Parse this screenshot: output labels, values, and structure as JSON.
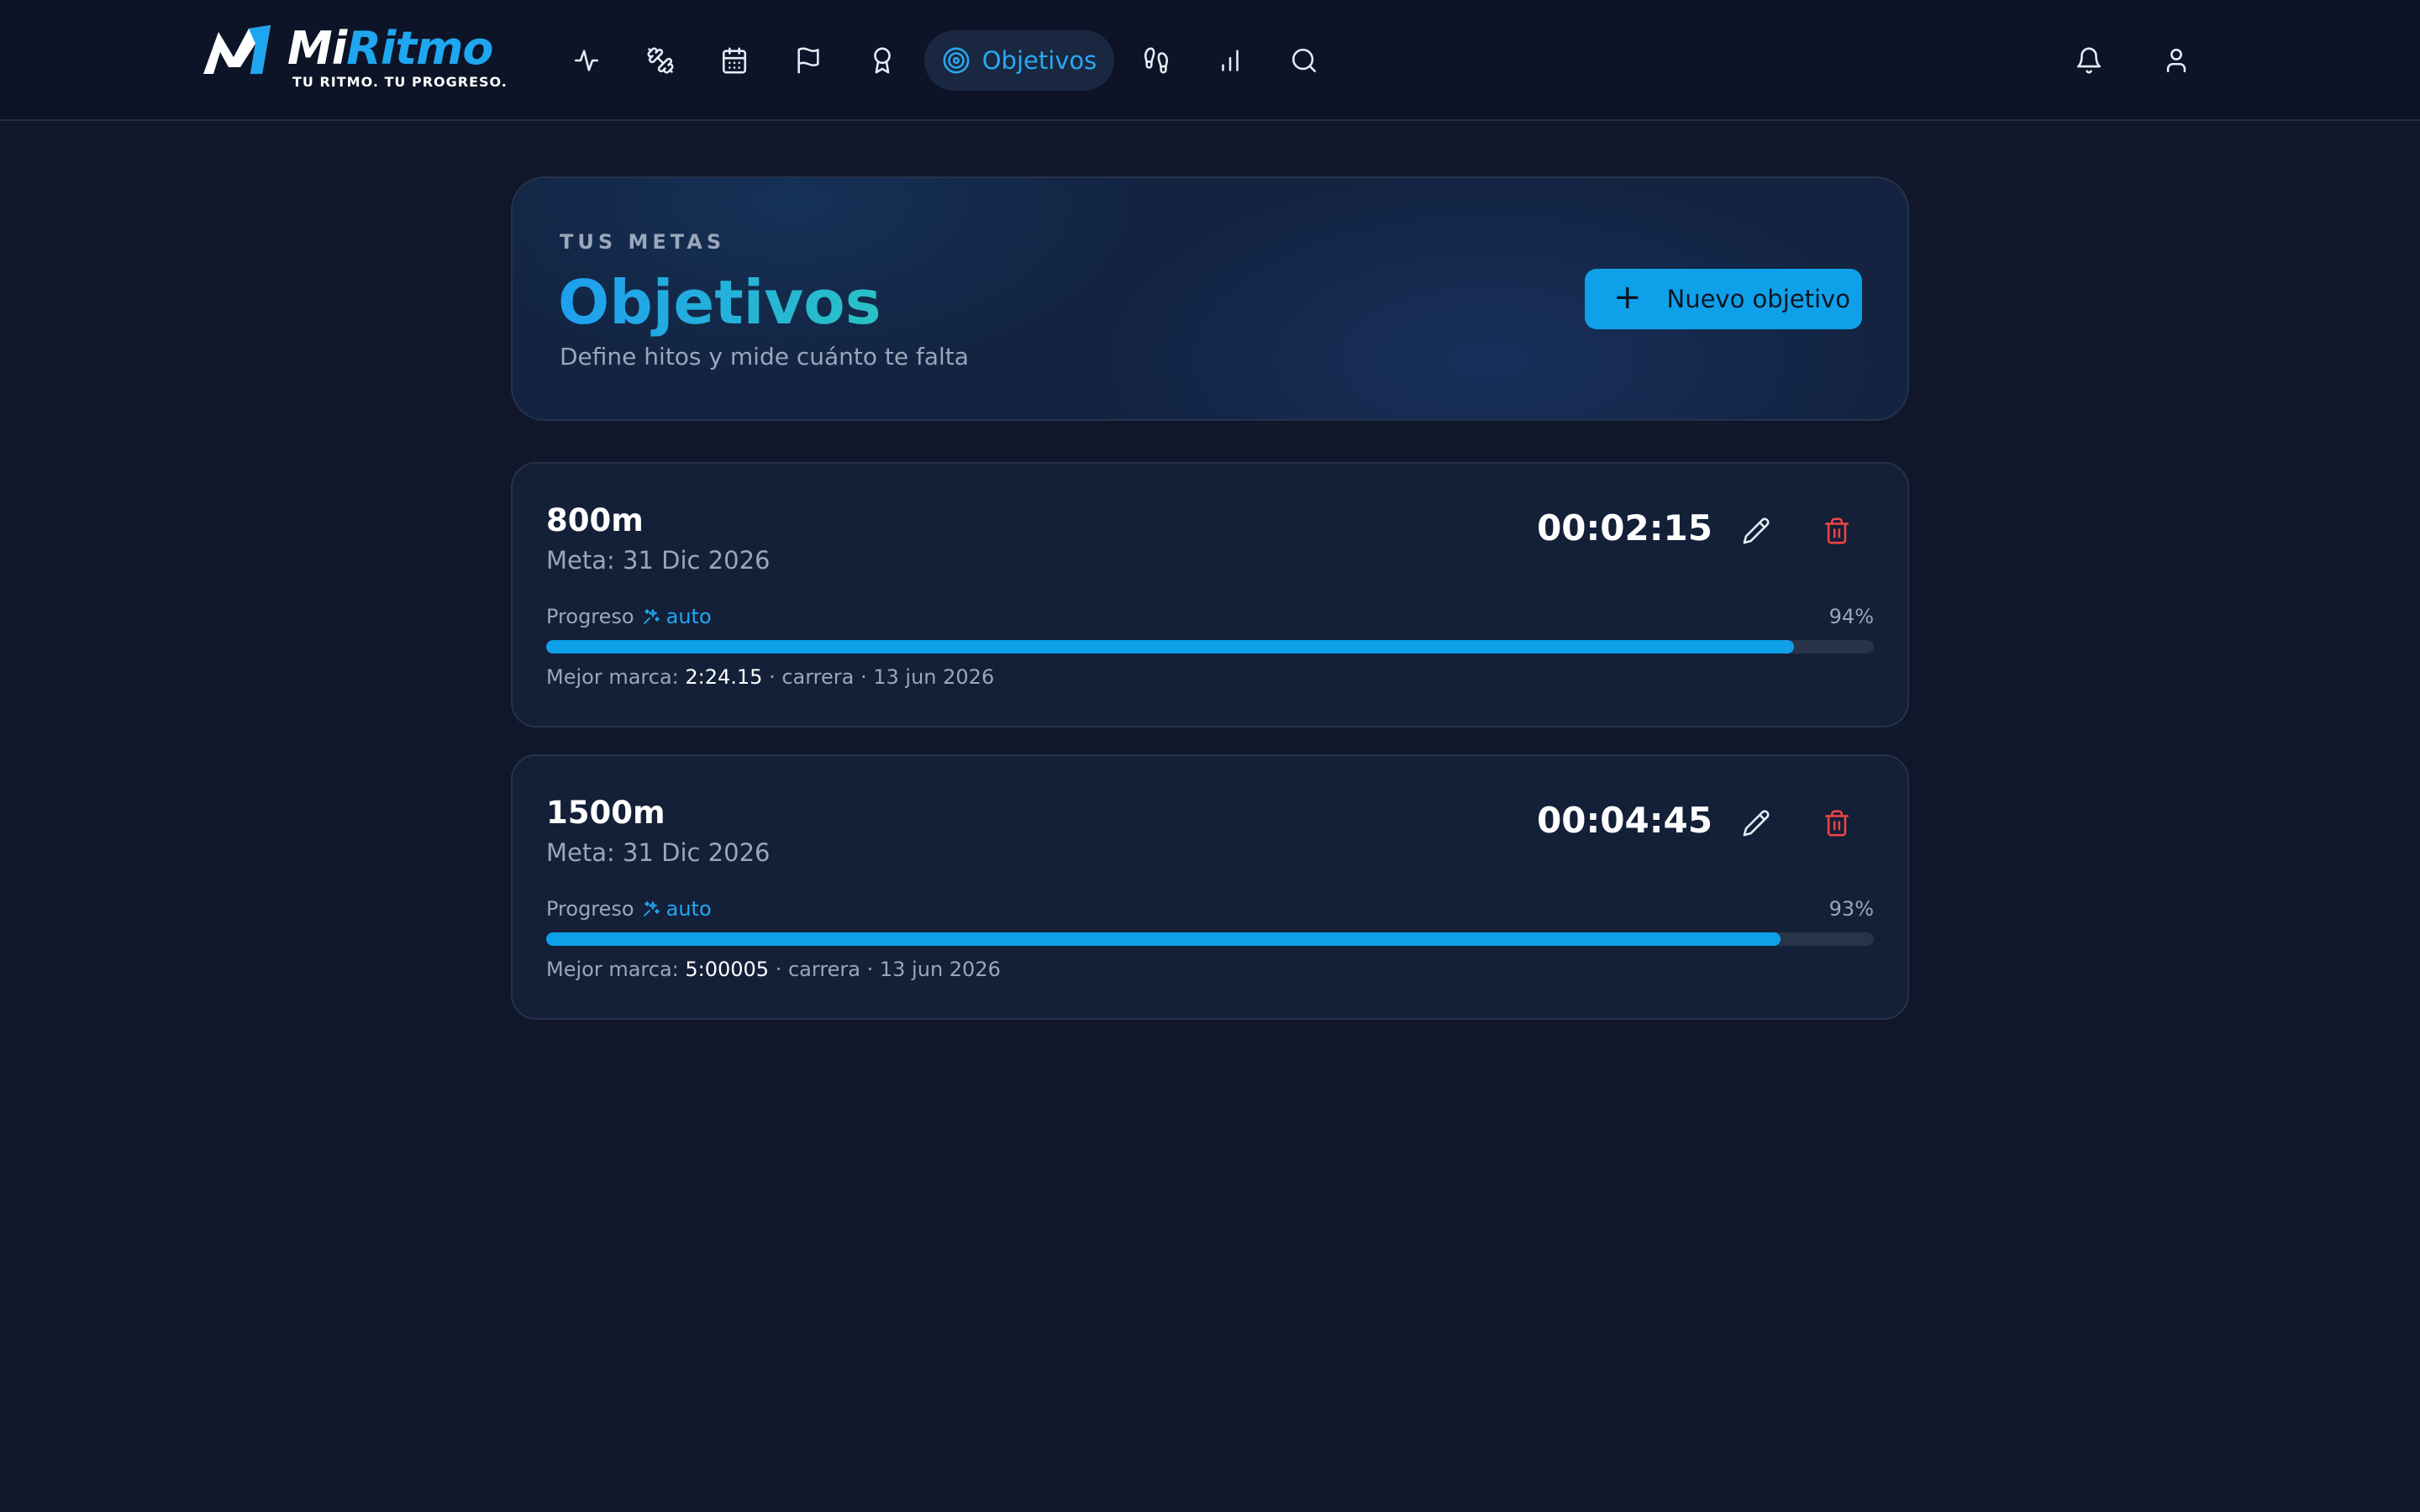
{
  "brand": {
    "name_part1": "Mi",
    "name_part2": "Ritmo",
    "tagline": "TU RITMO. TU PROGRESO."
  },
  "nav": {
    "items": [
      {
        "name": "activity",
        "icon": "activity-icon"
      },
      {
        "name": "training",
        "icon": "dumbbell-icon"
      },
      {
        "name": "calendar",
        "icon": "calendar-icon"
      },
      {
        "name": "races",
        "icon": "flag-icon"
      },
      {
        "name": "achievements",
        "icon": "award-icon"
      },
      {
        "name": "goals",
        "icon": "target-icon",
        "label": "Objetivos",
        "active": true
      },
      {
        "name": "shoes",
        "icon": "footprints-icon"
      },
      {
        "name": "stats",
        "icon": "bar-chart-icon"
      },
      {
        "name": "search",
        "icon": "search-icon"
      }
    ],
    "right": [
      {
        "name": "notifications",
        "icon": "bell-icon"
      },
      {
        "name": "profile",
        "icon": "user-icon"
      }
    ]
  },
  "header": {
    "eyebrow": "TUS METAS",
    "title": "Objetivos",
    "subtitle": "Define hitos y mide cuánto te falta",
    "new_button": "Nuevo objetivo"
  },
  "colors": {
    "accent": "#0ea1e9",
    "danger": "#ef4444",
    "background": "#10172a"
  },
  "goals": [
    {
      "name": "800m",
      "date": "Meta: 31 Dic 2026",
      "time": "00:02:15",
      "progress_label": "Progreso",
      "auto_label": "auto",
      "progress": 94,
      "progress_text": "94%",
      "best_label": "Mejor marca:",
      "best_mark": "2:24.15",
      "best_detail": "· carrera · 13 jun 2026"
    },
    {
      "name": "1500m",
      "date": "Meta: 31 Dic 2026",
      "time": "00:04:45",
      "progress_label": "Progreso",
      "auto_label": "auto",
      "progress": 93,
      "progress_text": "93%",
      "best_label": "Mejor marca:",
      "best_mark": "5:00005",
      "best_detail": "· carrera · 13 jun 2026"
    }
  ]
}
